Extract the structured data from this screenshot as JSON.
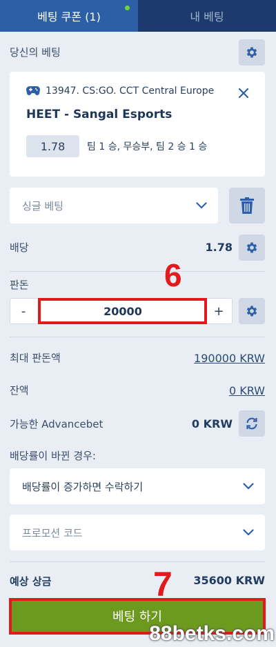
{
  "tabs": [
    {
      "label": "베팅 쿠폰 (1)"
    },
    {
      "label": "내 베팅"
    }
  ],
  "your_bets_label": "당신의 베팅",
  "bet": {
    "league": "13947. CS:GO. CCT Central Europe",
    "event": "HEET - Sangal Esports",
    "odds": "1.78",
    "pick": "팀 1 승, 무승부, 팀 2 승 1 승"
  },
  "bet_type_select": {
    "value": "싱글 베팅"
  },
  "odds_row": {
    "label": "배당",
    "value": "1.78"
  },
  "stake": {
    "label": "판돈",
    "value": "20000",
    "minus": "-",
    "plus": "+"
  },
  "max_stake": {
    "label": "최대 판돈액",
    "value": "190000 KRW"
  },
  "balance": {
    "label": "잔액",
    "value": "0 KRW"
  },
  "advancebet": {
    "label": "가능한 Advancebet",
    "value": "0 KRW"
  },
  "odds_change": {
    "label": "배당률이 바뀐 경우:",
    "value": "배당률이 증가하면 수락하기"
  },
  "promo": {
    "placeholder": "프로모션 코드"
  },
  "potential_win": {
    "label": "예상 상금",
    "value": "35600 KRW"
  },
  "place_bet_label": "베팅 하기",
  "annotations": {
    "step6": "6",
    "step7": "7"
  },
  "watermark": "88betks.com",
  "colors": {
    "tab_bar": "#1c3a6d",
    "tab_active": "#2c5fa6",
    "place_button": "#6c9a1f",
    "highlight": "#e11b1b"
  }
}
